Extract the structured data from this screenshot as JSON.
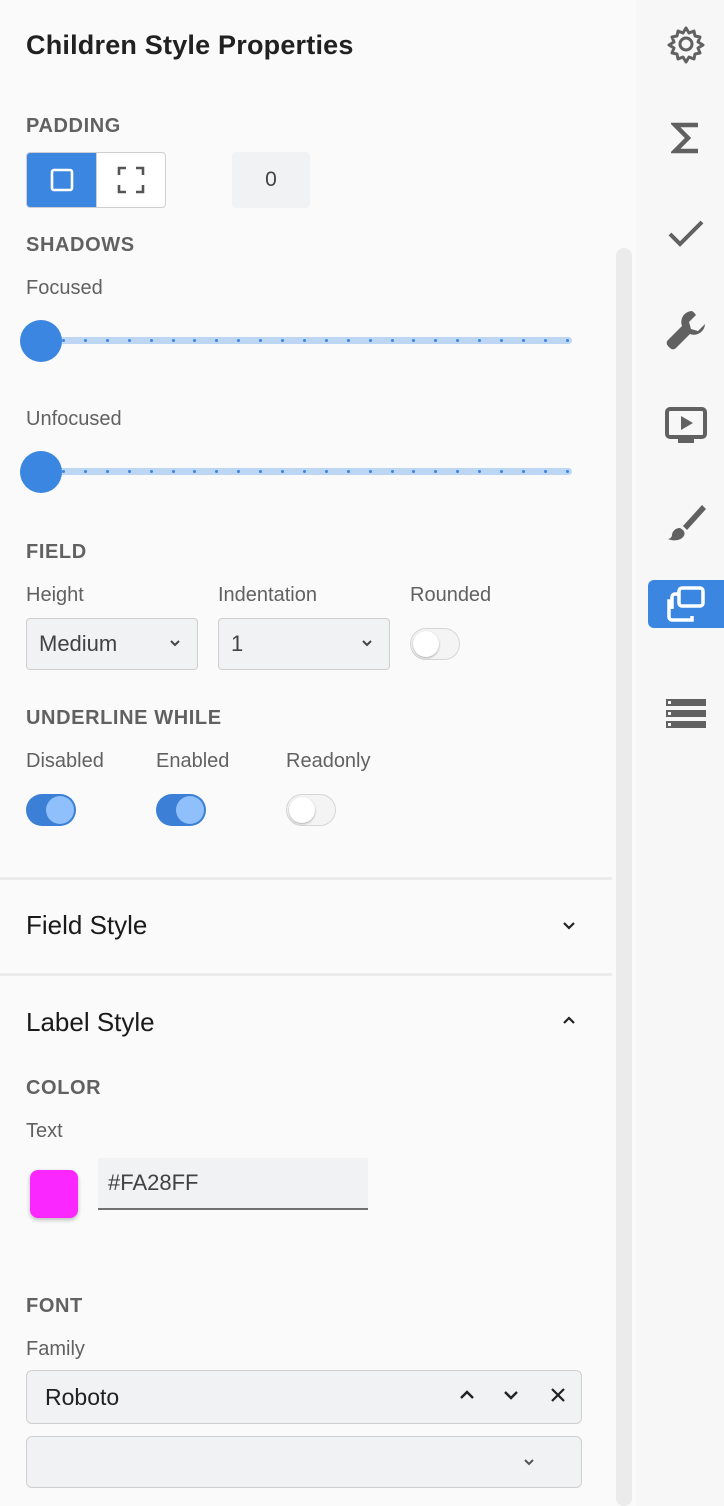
{
  "title": "Children Style Properties",
  "padding": {
    "label": "PADDING",
    "value": "0",
    "modes": [
      "single-side-icon",
      "all-sides-icon"
    ],
    "active_mode": "single-side-icon"
  },
  "shadows": {
    "label": "SHADOWS",
    "focused_label": "Focused",
    "focused_value": 0,
    "unfocused_label": "Unfocused",
    "unfocused_value": 0
  },
  "field": {
    "label": "FIELD",
    "height_label": "Height",
    "height_value": "Medium",
    "indentation_label": "Indentation",
    "indentation_value": "1",
    "rounded_label": "Rounded",
    "rounded_on": false
  },
  "underline": {
    "label": "UNDERLINE WHILE",
    "disabled_label": "Disabled",
    "disabled_on": true,
    "enabled_label": "Enabled",
    "enabled_on": true,
    "readonly_label": "Readonly",
    "readonly_on": false
  },
  "field_style": {
    "title": "Field Style",
    "expanded": false
  },
  "label_style": {
    "title": "Label Style",
    "expanded": true,
    "color_label": "COLOR",
    "text_label": "Text",
    "text_color": "#FA28FF",
    "font_label": "FONT",
    "family_label": "Family",
    "family_value": "Roboto",
    "secondary_value": ""
  },
  "colors": {
    "accent": "#3b86e0",
    "swatch": "#FA28FF"
  },
  "rail": [
    "gear-icon",
    "sigma-icon",
    "check-icon",
    "wrench-icon",
    "preview-icon",
    "brush-icon",
    "layers-icon",
    "list-icon"
  ],
  "rail_active": "layers-icon"
}
